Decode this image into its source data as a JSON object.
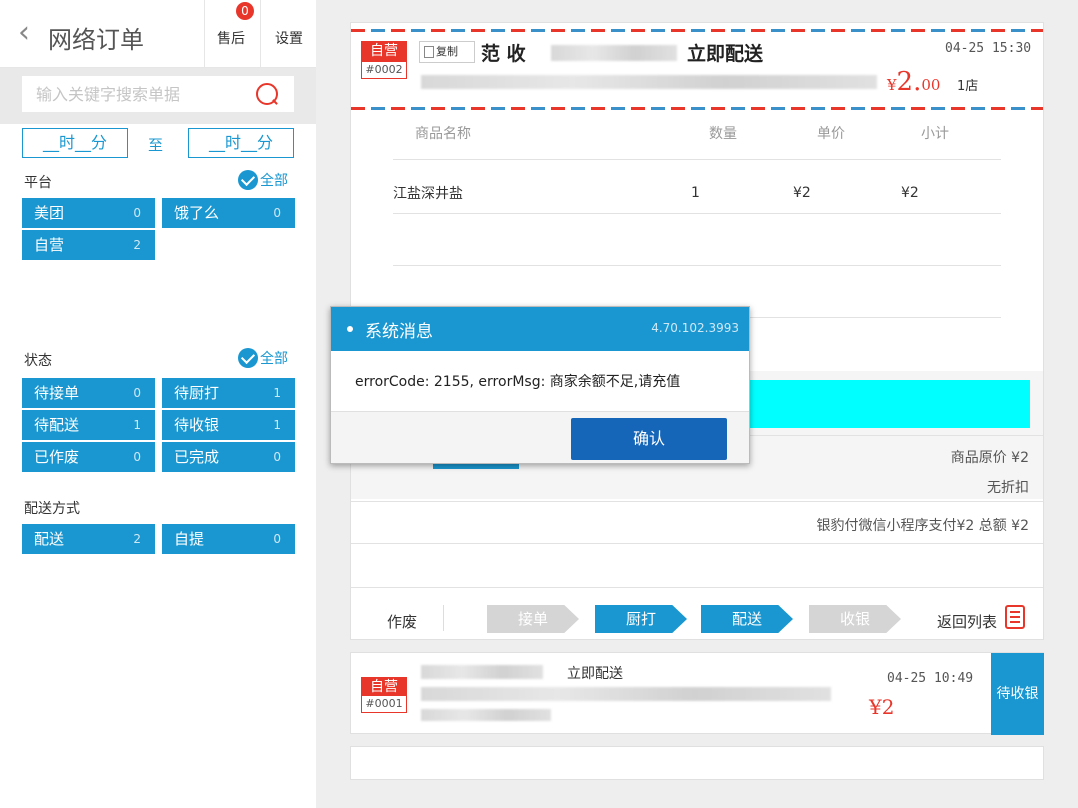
{
  "header": {
    "back_icon": "chevron-left-icon",
    "title": "网络订单",
    "after_sales": {
      "label": "售后",
      "badge": "0"
    },
    "settings": "设置"
  },
  "search": {
    "placeholder": "输入关键字搜索单据"
  },
  "time_range": {
    "start": "__时__分",
    "separator": "至",
    "end": "__时__分"
  },
  "platform": {
    "label": "平台",
    "all": "全部",
    "items": [
      {
        "label": "美团",
        "count": "0"
      },
      {
        "label": "饿了么",
        "count": "0"
      },
      {
        "label": "自营",
        "count": "2"
      }
    ]
  },
  "status": {
    "label": "状态",
    "all": "全部",
    "items": [
      {
        "label": "待接单",
        "count": "0"
      },
      {
        "label": "待厨打",
        "count": "1"
      },
      {
        "label": "待配送",
        "count": "1"
      },
      {
        "label": "待收银",
        "count": "1"
      },
      {
        "label": "已作废",
        "count": "0"
      },
      {
        "label": "已完成",
        "count": "0"
      }
    ]
  },
  "delivery": {
    "label": "配送方式",
    "items": [
      {
        "label": "配送",
        "count": "2"
      },
      {
        "label": "自提",
        "count": "0"
      }
    ]
  },
  "order1": {
    "tag": "自营",
    "number": "#0002",
    "copy": "复制",
    "name": "范 收",
    "mode": "立即配送",
    "time": "04-25 15:30",
    "amount_currency": "¥",
    "amount_int": "2.",
    "amount_dec": "00",
    "store": "1店",
    "table_headers": [
      "商品名称",
      "数量",
      "单价",
      "小计"
    ],
    "items": [
      {
        "name": "江盐深井盐",
        "qty": "1",
        "price": "¥2",
        "subtotal": "¥2"
      }
    ],
    "original_price": "商品原价 ¥2",
    "discount": "无折扣",
    "payment": "银豹付微信小程序支付¥2   总额 ¥2",
    "actions": {
      "void": "作废",
      "steps": [
        {
          "label": "接单",
          "active": false
        },
        {
          "label": "厨打",
          "active": true
        },
        {
          "label": "配送",
          "active": true
        },
        {
          "label": "收银",
          "active": false
        }
      ],
      "back_to_list": "返回列表"
    }
  },
  "order2": {
    "tag": "自营",
    "number": "#0001",
    "mode": "立即配送",
    "time": "04-25 10:49",
    "amount": "¥2",
    "status": "待收银"
  },
  "modal": {
    "title": "系统消息",
    "version": "4.70.102.3993",
    "message": "errorCode: 2155, errorMsg: 商家余额不足,请充值",
    "confirm": "确认"
  },
  "colors": {
    "accent": "#1a97d0",
    "danger": "#e8362b",
    "confirm": "#1565b8",
    "highlight": "#00ffff"
  }
}
